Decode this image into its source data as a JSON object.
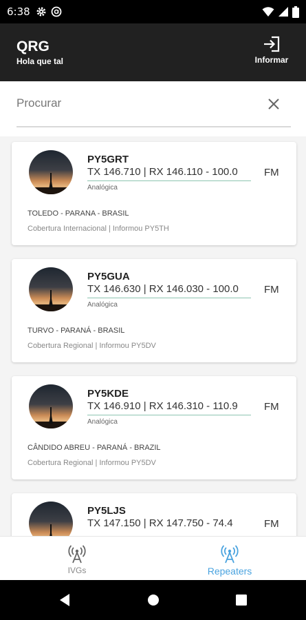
{
  "status_bar": {
    "time": "6:38"
  },
  "app_bar": {
    "title": "QRG",
    "subtitle": "Hola que tal",
    "report_label": "Informar"
  },
  "search": {
    "placeholder": "Procurar"
  },
  "repeaters": [
    {
      "callsign": "PY5GRT",
      "frequency": "TX 146.710 | RX 146.110 - 100.0",
      "mode_type": "Analógica",
      "mode": "FM",
      "location": "TOLEDO - PARANA - BRASIL",
      "info": "Cobertura Internacional | Informou PY5TH"
    },
    {
      "callsign": "PY5GUA",
      "frequency": "TX 146.630 | RX 146.030 - 100.0",
      "mode_type": "Analógica",
      "mode": "FM",
      "location": "TURVO - PARANÁ  - BRASIL",
      "info": "Cobertura Regional | Informou PY5DV"
    },
    {
      "callsign": "PY5KDE",
      "frequency": "TX 146.910 | RX 146.310 - 110.9",
      "mode_type": "Analógica",
      "mode": "FM",
      "location": "CÂNDIDO ABREU - PARANÁ  - BRAZIL",
      "info": "Cobertura Regional | Informou PY5DV"
    },
    {
      "callsign": "PY5LJS",
      "frequency": "TX 147.150 | RX 147.750 - 74.4",
      "mode": "FM"
    }
  ],
  "bottom_nav": {
    "items": [
      {
        "label": "IVGs",
        "icon": "antenna-icon",
        "active": false
      },
      {
        "label": "Repeaters",
        "icon": "antenna-icon",
        "active": true
      }
    ]
  },
  "colors": {
    "app_bar": "#212121",
    "accent": "#4aa3df",
    "underline": "#8cc4b0"
  }
}
